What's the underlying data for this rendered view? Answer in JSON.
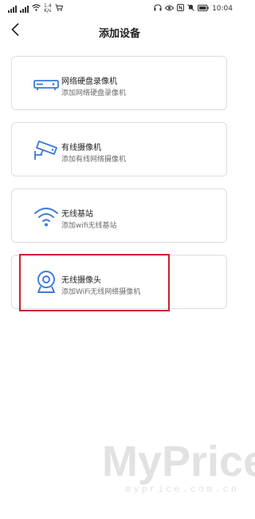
{
  "status_bar": {
    "left_icons": [
      "signal-1-icon",
      "signal-2-icon",
      "wifi-icon",
      "network-speed",
      "cart-icon"
    ],
    "network_speed": "1.4\nK/s",
    "right_icons": [
      "headphones-icon",
      "eye-icon",
      "nfc-icon",
      "mute-icon",
      "battery-icon"
    ],
    "time": "10:04"
  },
  "header": {
    "back_icon": "chevron-left-icon",
    "title": "添加设备"
  },
  "devices": [
    {
      "icon": "nvr-icon",
      "name": "网络硬盘录像机",
      "description": "添加网络硬盘录像机"
    },
    {
      "icon": "wired-camera-icon",
      "name": "有线摄像机",
      "description": "添加有线网络摄像机"
    },
    {
      "icon": "wireless-base-station-icon",
      "name": "无线基站",
      "description": "添加wifi无线基站"
    },
    {
      "icon": "wireless-camera-icon",
      "name": "无线摄像头",
      "description": "添加WiFi无线网络摄像机"
    }
  ],
  "highlighted_device": "无线摄像头",
  "colors": {
    "accent_blue": "#3d7bd6",
    "card_border": "#d9dee5",
    "highlight_red": "#c8232e"
  },
  "watermark": {
    "main": "MyPrice",
    "sub": "myprice.com.cn"
  }
}
